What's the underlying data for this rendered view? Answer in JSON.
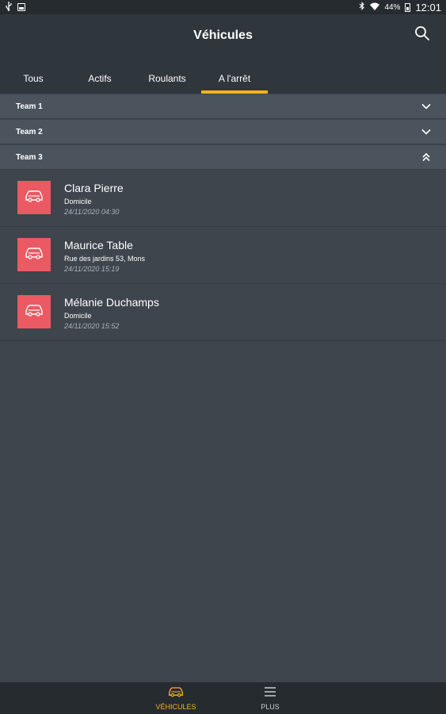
{
  "status_bar": {
    "battery": "44%",
    "time": "12:01"
  },
  "header": {
    "title": "Véhicules"
  },
  "tabs": [
    {
      "label": "Tous"
    },
    {
      "label": "Actifs"
    },
    {
      "label": "Roulants"
    },
    {
      "label": "A l'arrêt"
    }
  ],
  "active_tab": "A l'arrêt",
  "groups": [
    {
      "label": "Team 1",
      "expanded": false
    },
    {
      "label": "Team 2",
      "expanded": false
    },
    {
      "label": "Team 3",
      "expanded": true
    }
  ],
  "vehicles": [
    {
      "name": "Clara Pierre",
      "place": "Domicile",
      "time": "24/11/2020 04:30"
    },
    {
      "name": "Maurice Table",
      "place": "Rue des jardins 53, Mons",
      "time": "24/11/2020 15:19"
    },
    {
      "name": "Mélanie Duchamps",
      "place": "Domicile",
      "time": "24/11/2020 15:52"
    }
  ],
  "bottom_nav": {
    "vehicles_label": "VÉHICULES",
    "more_label": "PLUS"
  },
  "colors": {
    "accent": "#f5b31f",
    "vehicle_stopped": "#eb5a62",
    "background": "#3e454c",
    "header": "#2f363c"
  },
  "icons": {
    "search": "search-icon",
    "chevron_down": "chevron-down-icon",
    "chevron_up_double": "double-chevron-up-icon",
    "car": "car-icon",
    "menu": "menu-icon"
  }
}
